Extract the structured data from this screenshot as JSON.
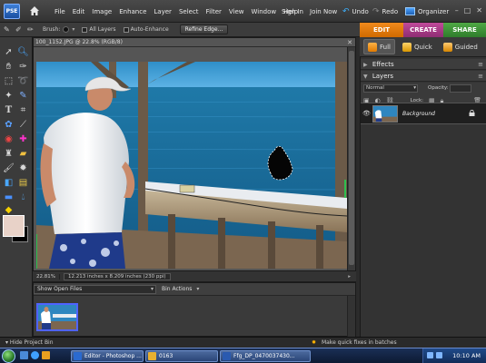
{
  "app": {
    "logo_text": "PSE",
    "menu": [
      "File",
      "Edit",
      "Image",
      "Enhance",
      "Layer",
      "Select",
      "Filter",
      "View",
      "Window",
      "Help"
    ],
    "sign_in": "Sign In",
    "join_now": "Join Now",
    "undo": "Undo",
    "redo": "Redo",
    "organizer": "Organizer"
  },
  "options_bar": {
    "brush_label": "Brush:",
    "all_layers": "All Layers",
    "auto_enhance": "Auto-Enhance",
    "refine_edge": "Refine Edge..."
  },
  "mode_tabs": {
    "edit": "EDIT",
    "create": "CREATE",
    "share": "SHARE",
    "sub": [
      "Full",
      "Quick",
      "Guided"
    ]
  },
  "document": {
    "title": "100_1152.JPG @ 22.8% (RGB/8)",
    "zoom": "22.81%",
    "dimensions": "12.213 inches x 8.209 inches (230 ppi)"
  },
  "project_bin": {
    "show": "Show Open Files",
    "actions": "Bin Actions",
    "hide_label": "Hide Project Bin"
  },
  "panels": {
    "effects": "Effects",
    "layers": "Layers",
    "blend_mode": "Normal",
    "opacity_label": "Opacity:",
    "lock_label": "Lock:",
    "layer_name": "Background"
  },
  "hint": "Make quick fixes in batches",
  "taskbar": {
    "buttons": [
      "Editor - Photoshop ...",
      "0163",
      "Ffg_DP_0470037430..."
    ],
    "time": "10:10 AM"
  },
  "colors": {
    "foreground": "#e8d2c8",
    "background": "#000000",
    "edit_tab": "#e87d12",
    "create_tab": "#a83a88",
    "share_tab": "#3e9a3a"
  }
}
